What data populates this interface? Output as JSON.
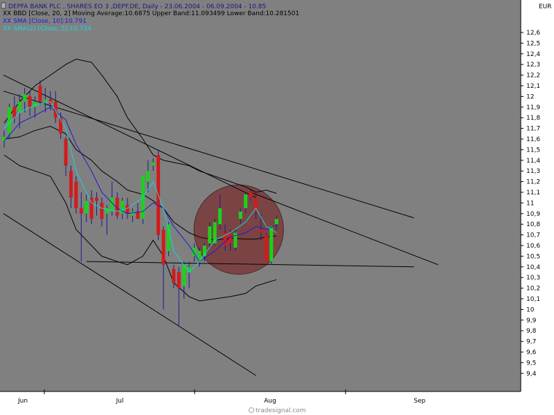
{
  "chart_data": {
    "type": "candlestick",
    "currency": "EUR",
    "legend": [
      {
        "text": "DEPFA BANK PLC , SHARES EO 3 ,DEPF.DE, Daily - 23.06.2004 - 06.09.2004 - 10.85",
        "color": "#1a1a7a"
      },
      {
        "text": "XX BBD [Close, 20, 2] Moving Average:10.6875 Upper Band:11.093499 Lower Band:10.281501",
        "color": "#000000"
      },
      {
        "text": "XX SMA [Close, 10]:10.791",
        "color": "#1a1ad6"
      },
      {
        "text": "XX SMA(2) [Close, 5]:10.724",
        "color": "#1ad6d6"
      }
    ],
    "y_ticks": [
      "12,6",
      "12,5",
      "12,4",
      "12,3",
      "12,2",
      "12,1",
      "12",
      "11,9",
      "11,8",
      "11,7",
      "11,6",
      "11,5",
      "11,4",
      "11,3",
      "11,2",
      "11,1",
      "11",
      "10,9",
      "10,8",
      "10,7",
      "10,6",
      "10,5",
      "10,4",
      "10,3",
      "10,2",
      "10,1",
      "10",
      "9,9",
      "9,8",
      "9,7",
      "9,6",
      "9,5",
      "9,4"
    ],
    "ylim": [
      9.35,
      12.7
    ],
    "x_tick_labels": [
      "Jun",
      "Jul",
      "Aug",
      "Sep"
    ],
    "x_tick_dates": [
      "2004-06-01",
      "2004-07-01",
      "2004-08-02",
      "2004-09-01"
    ],
    "candles": [
      {
        "date": "2004-06-23",
        "open": 11.58,
        "high": 11.68,
        "low": 11.52,
        "close": 11.62
      },
      {
        "date": "2004-06-24",
        "open": 11.65,
        "high": 11.93,
        "low": 11.6,
        "close": 11.9
      },
      {
        "date": "2004-06-25",
        "open": 11.9,
        "high": 12.0,
        "low": 11.75,
        "close": 11.8
      },
      {
        "date": "2004-06-28",
        "open": 11.85,
        "high": 12.02,
        "low": 11.7,
        "close": 11.95
      },
      {
        "date": "2004-06-29",
        "open": 11.95,
        "high": 12.08,
        "low": 11.85,
        "close": 12.02
      },
      {
        "date": "2004-06-30",
        "open": 12.0,
        "high": 12.05,
        "low": 11.82,
        "close": 11.9
      },
      {
        "date": "2004-07-01",
        "open": 11.9,
        "high": 12.0,
        "low": 11.8,
        "close": 11.95
      },
      {
        "date": "2004-07-02",
        "open": 12.1,
        "high": 12.15,
        "low": 11.92,
        "close": 11.95
      },
      {
        "date": "2004-07-05",
        "open": 11.95,
        "high": 12.08,
        "low": 11.85,
        "close": 11.97
      },
      {
        "date": "2004-07-06",
        "open": 11.97,
        "high": 12.05,
        "low": 11.87,
        "close": 11.93
      },
      {
        "date": "2004-07-07",
        "open": 11.95,
        "high": 12.05,
        "low": 11.75,
        "close": 11.8
      },
      {
        "date": "2004-07-08",
        "open": 11.8,
        "high": 11.85,
        "low": 11.6,
        "close": 11.65
      },
      {
        "date": "2004-07-09",
        "open": 11.6,
        "high": 11.62,
        "low": 11.25,
        "close": 11.35
      },
      {
        "date": "2004-07-12",
        "open": 11.3,
        "high": 11.35,
        "low": 10.95,
        "close": 11.05
      },
      {
        "date": "2004-07-13",
        "open": 11.2,
        "high": 11.25,
        "low": 10.9,
        "close": 10.95
      },
      {
        "date": "2004-07-14",
        "open": 10.95,
        "high": 11.1,
        "low": 10.45,
        "close": 10.9
      },
      {
        "date": "2004-07-15",
        "open": 10.9,
        "high": 11.08,
        "low": 10.82,
        "close": 11.02
      },
      {
        "date": "2004-07-16",
        "open": 11.05,
        "high": 11.12,
        "low": 10.8,
        "close": 10.85
      },
      {
        "date": "2004-07-19",
        "open": 11.05,
        "high": 11.1,
        "low": 10.88,
        "close": 11.02
      },
      {
        "date": "2004-07-20",
        "open": 11.0,
        "high": 11.05,
        "low": 10.78,
        "close": 10.85
      },
      {
        "date": "2004-07-21",
        "open": 10.9,
        "high": 10.98,
        "low": 10.7,
        "close": 10.95
      },
      {
        "date": "2004-07-22",
        "open": 10.92,
        "high": 11.2,
        "low": 10.88,
        "close": 11.05
      },
      {
        "date": "2004-07-23",
        "open": 11.05,
        "high": 11.1,
        "low": 10.85,
        "close": 10.88
      },
      {
        "date": "2004-07-26",
        "open": 10.9,
        "high": 11.05,
        "low": 10.85,
        "close": 11.02
      },
      {
        "date": "2004-07-27",
        "open": 10.98,
        "high": 11.05,
        "low": 10.85,
        "close": 10.9
      },
      {
        "date": "2004-07-28",
        "open": 10.88,
        "high": 10.95,
        "low": 10.82,
        "close": 10.92
      },
      {
        "date": "2004-07-29",
        "open": 10.92,
        "high": 11.0,
        "low": 10.85,
        "close": 10.85
      },
      {
        "date": "2004-07-30",
        "open": 10.85,
        "high": 11.25,
        "low": 10.8,
        "close": 11.25
      },
      {
        "date": "2004-08-02",
        "open": 11.2,
        "high": 11.4,
        "low": 11.1,
        "close": 11.3
      },
      {
        "date": "2004-08-03",
        "open": 11.35,
        "high": 11.42,
        "low": 11.3,
        "close": 11.38
      },
      {
        "date": "2004-08-04",
        "open": 11.45,
        "high": 11.5,
        "low": 10.65,
        "close": 10.7
      },
      {
        "date": "2004-08-05",
        "open": 10.75,
        "high": 10.78,
        "low": 10.0,
        "close": 10.42
      },
      {
        "date": "2004-08-06",
        "open": 10.55,
        "high": 10.82,
        "low": 10.5,
        "close": 10.8
      },
      {
        "date": "2004-08-09",
        "open": 10.38,
        "high": 10.42,
        "low": 10.2,
        "close": 10.25
      },
      {
        "date": "2004-08-10",
        "open": 10.35,
        "high": 10.4,
        "low": 9.85,
        "close": 10.2
      },
      {
        "date": "2004-08-11",
        "open": 10.22,
        "high": 10.45,
        "low": 10.1,
        "close": 10.42
      },
      {
        "date": "2004-08-12",
        "open": 10.35,
        "high": 10.45,
        "low": 10.2,
        "close": 10.4
      },
      {
        "date": "2004-08-13",
        "open": 10.5,
        "high": 10.62,
        "low": 10.45,
        "close": 10.58
      },
      {
        "date": "2004-08-16",
        "open": 10.45,
        "high": 10.58,
        "low": 10.4,
        "close": 10.55
      },
      {
        "date": "2004-08-17",
        "open": 10.5,
        "high": 10.62,
        "low": 10.45,
        "close": 10.6
      },
      {
        "date": "2004-08-18",
        "open": 10.62,
        "high": 10.82,
        "low": 10.58,
        "close": 10.78
      },
      {
        "date": "2004-08-19",
        "open": 10.62,
        "high": 10.85,
        "low": 10.6,
        "close": 10.82
      },
      {
        "date": "2004-08-20",
        "open": 10.8,
        "high": 11.08,
        "low": 10.75,
        "close": 10.95
      },
      {
        "date": "2004-08-23",
        "open": 10.72,
        "high": 10.8,
        "low": 10.55,
        "close": 10.6
      },
      {
        "date": "2004-08-24",
        "open": 10.72,
        "high": 10.75,
        "low": 10.55,
        "close": 10.62
      },
      {
        "date": "2004-08-25",
        "open": 10.58,
        "high": 10.75,
        "low": 10.55,
        "close": 10.72
      },
      {
        "date": "2004-08-26",
        "open": 10.85,
        "high": 10.95,
        "low": 10.8,
        "close": 10.92
      },
      {
        "date": "2004-08-27",
        "open": 10.95,
        "high": 11.1,
        "low": 10.9,
        "close": 11.08
      },
      {
        "date": "2004-08-30",
        "open": 11.1,
        "high": 11.12,
        "low": 11.02,
        "close": 11.05
      },
      {
        "date": "2004-08-31",
        "open": 11.05,
        "high": 11.08,
        "low": 10.85,
        "close": 10.92
      },
      {
        "date": "2004-09-01",
        "open": 10.75,
        "high": 10.9,
        "low": 10.65,
        "close": 10.72
      },
      {
        "date": "2004-09-02",
        "open": 10.7,
        "high": 10.72,
        "low": 10.45,
        "close": 10.45
      },
      {
        "date": "2004-09-03",
        "open": 10.45,
        "high": 10.78,
        "low": 10.42,
        "close": 10.78
      },
      {
        "date": "2004-09-06",
        "open": 10.8,
        "high": 10.88,
        "low": 10.75,
        "close": 10.85
      }
    ],
    "series": [
      {
        "name": "SMA [Close, 10]",
        "color": "#1a1ad6",
        "values": [
          [
            "2004-06-23",
            11.58
          ],
          [
            "2004-06-28",
            11.75
          ],
          [
            "2004-07-01",
            11.82
          ],
          [
            "2004-07-06",
            11.9
          ],
          [
            "2004-07-09",
            11.78
          ],
          [
            "2004-07-13",
            11.55
          ],
          [
            "2004-07-16",
            11.3
          ],
          [
            "2004-07-20",
            11.1
          ],
          [
            "2004-07-23",
            10.95
          ],
          [
            "2004-07-27",
            10.9
          ],
          [
            "2004-07-30",
            10.92
          ],
          [
            "2004-08-03",
            11.0
          ],
          [
            "2004-08-05",
            10.95
          ],
          [
            "2004-08-09",
            10.78
          ],
          [
            "2004-08-12",
            10.6
          ],
          [
            "2004-08-16",
            10.45
          ],
          [
            "2004-08-19",
            10.55
          ],
          [
            "2004-08-24",
            10.68
          ],
          [
            "2004-08-27",
            10.72
          ],
          [
            "2004-08-31",
            10.78
          ],
          [
            "2004-09-02",
            10.75
          ],
          [
            "2004-09-06",
            10.79
          ]
        ]
      },
      {
        "name": "SMA(2) [Close, 5]",
        "color": "#1ad6d6",
        "values": [
          [
            "2004-06-23",
            11.7
          ],
          [
            "2004-06-28",
            11.85
          ],
          [
            "2004-07-01",
            11.92
          ],
          [
            "2004-07-06",
            11.95
          ],
          [
            "2004-07-09",
            11.7
          ],
          [
            "2004-07-13",
            11.3
          ],
          [
            "2004-07-16",
            11.0
          ],
          [
            "2004-07-20",
            10.95
          ],
          [
            "2004-07-23",
            10.92
          ],
          [
            "2004-07-27",
            10.95
          ],
          [
            "2004-07-30",
            11.05
          ],
          [
            "2004-08-03",
            11.2
          ],
          [
            "2004-08-05",
            10.95
          ],
          [
            "2004-08-09",
            10.55
          ],
          [
            "2004-08-12",
            10.35
          ],
          [
            "2004-08-16",
            10.45
          ],
          [
            "2004-08-19",
            10.65
          ],
          [
            "2004-08-24",
            10.72
          ],
          [
            "2004-08-27",
            10.82
          ],
          [
            "2004-08-31",
            10.95
          ],
          [
            "2004-09-02",
            10.78
          ],
          [
            "2004-09-06",
            10.72
          ]
        ]
      },
      {
        "name": "Upper Band",
        "color": "#000000",
        "values": [
          [
            "2004-06-23",
            11.75
          ],
          [
            "2004-06-28",
            11.95
          ],
          [
            "2004-07-01",
            12.1
          ],
          [
            "2004-07-06",
            12.2
          ],
          [
            "2004-07-09",
            12.3
          ],
          [
            "2004-07-13",
            12.35
          ],
          [
            "2004-07-16",
            12.32
          ],
          [
            "2004-07-20",
            12.2
          ],
          [
            "2004-07-23",
            12.0
          ],
          [
            "2004-07-27",
            11.8
          ],
          [
            "2004-07-30",
            11.6
          ],
          [
            "2004-08-03",
            11.45
          ],
          [
            "2004-08-05",
            11.4
          ],
          [
            "2004-08-09",
            11.38
          ],
          [
            "2004-08-12",
            11.35
          ],
          [
            "2004-08-16",
            11.3
          ],
          [
            "2004-08-19",
            11.25
          ],
          [
            "2004-08-24",
            11.2
          ],
          [
            "2004-08-27",
            11.15
          ],
          [
            "2004-08-31",
            11.1
          ],
          [
            "2004-09-02",
            11.12
          ],
          [
            "2004-09-06",
            11.09
          ]
        ]
      },
      {
        "name": "Moving Average",
        "color": "#000000",
        "values": [
          [
            "2004-06-23",
            11.6
          ],
          [
            "2004-06-28",
            11.62
          ],
          [
            "2004-07-01",
            11.68
          ],
          [
            "2004-07-06",
            11.72
          ],
          [
            "2004-07-09",
            11.65
          ],
          [
            "2004-07-13",
            11.5
          ],
          [
            "2004-07-16",
            11.4
          ],
          [
            "2004-07-20",
            11.3
          ],
          [
            "2004-07-23",
            11.2
          ],
          [
            "2004-07-27",
            11.12
          ],
          [
            "2004-07-30",
            11.08
          ],
          [
            "2004-08-03",
            11.02
          ],
          [
            "2004-08-05",
            10.95
          ],
          [
            "2004-08-09",
            10.82
          ],
          [
            "2004-08-12",
            10.72
          ],
          [
            "2004-08-16",
            10.68
          ],
          [
            "2004-08-19",
            10.65
          ],
          [
            "2004-08-24",
            10.67
          ],
          [
            "2004-08-27",
            10.66
          ],
          [
            "2004-08-31",
            10.66
          ],
          [
            "2004-09-02",
            10.68
          ],
          [
            "2004-09-06",
            10.69
          ]
        ]
      },
      {
        "name": "Lower Band",
        "color": "#000000",
        "values": [
          [
            "2004-06-23",
            11.45
          ],
          [
            "2004-06-28",
            11.35
          ],
          [
            "2004-07-01",
            11.3
          ],
          [
            "2004-07-06",
            11.25
          ],
          [
            "2004-07-09",
            11.0
          ],
          [
            "2004-07-13",
            10.75
          ],
          [
            "2004-07-16",
            10.6
          ],
          [
            "2004-07-20",
            10.5
          ],
          [
            "2004-07-23",
            10.45
          ],
          [
            "2004-07-27",
            10.42
          ],
          [
            "2004-07-30",
            10.5
          ],
          [
            "2004-08-03",
            10.65
          ],
          [
            "2004-08-05",
            10.5
          ],
          [
            "2004-08-09",
            10.25
          ],
          [
            "2004-08-12",
            10.12
          ],
          [
            "2004-08-16",
            10.08
          ],
          [
            "2004-08-19",
            10.1
          ],
          [
            "2004-08-24",
            10.12
          ],
          [
            "2004-08-27",
            10.15
          ],
          [
            "2004-08-31",
            10.22
          ],
          [
            "2004-09-02",
            10.25
          ],
          [
            "2004-09-06",
            10.28
          ]
        ]
      }
    ],
    "trendlines": [
      {
        "from": [
          "2004-06-01",
          12.2
        ],
        "to": [
          "2004-08-31",
          11.05
        ]
      },
      {
        "from": [
          "2004-06-01",
          12.05
        ],
        "to": [
          "2004-09-14",
          10.86
        ]
      },
      {
        "from": [
          "2004-06-01",
          10.9
        ],
        "to": [
          "2004-08-31",
          9.38
        ]
      },
      {
        "from": [
          "2004-07-15",
          10.45
        ],
        "to": [
          "2004-09-14",
          10.4
        ]
      },
      {
        "from": [
          "2004-08-30",
          11.1
        ],
        "to": [
          "2004-09-18",
          10.42
        ]
      }
    ],
    "highlight_circle": {
      "center": [
        "2004-08-27",
        10.75
      ],
      "radius_y": 0.42,
      "fill": "#7a3a3a",
      "stroke": "#4a2a2a"
    },
    "watermark": "tradesignal.com",
    "colors": {
      "background": "#808080",
      "bull": "#1bd21b",
      "bear": "#d21b1b"
    }
  }
}
